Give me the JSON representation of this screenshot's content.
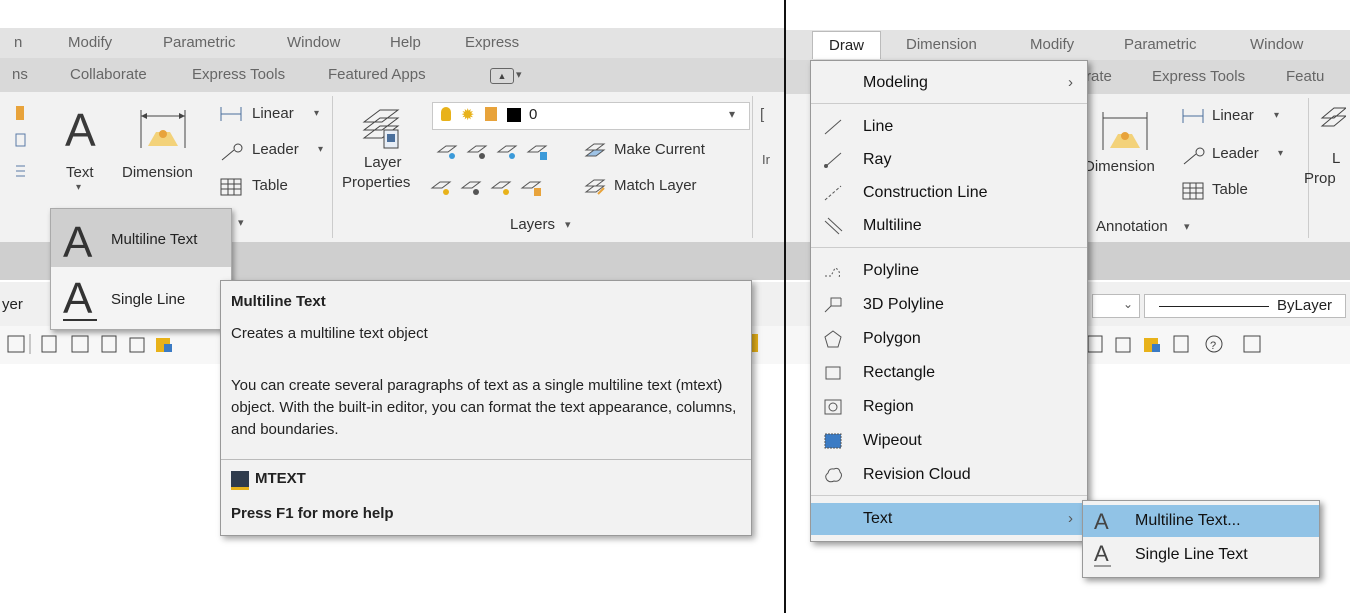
{
  "left": {
    "menubar": [
      "n",
      "Modify",
      "Parametric",
      "Window",
      "Help",
      "Express"
    ],
    "tabs": [
      "ns",
      "Collaborate",
      "Express Tools",
      "Featured Apps"
    ],
    "ribbon": {
      "text_label": "Text",
      "dimension_label": "Dimension",
      "linear_label": "Linear",
      "leader_label": "Leader",
      "table_label": "Table",
      "layer_props_label_1": "Layer",
      "layer_props_label_2": "Properties",
      "layer_value": "0",
      "make_current_label": "Make Current",
      "match_layer_label": "Match Layer",
      "layers_panel_label": "Layers",
      "edge_label": "Ir"
    },
    "propbar": {
      "layer_fragment": "yer"
    },
    "text_dropdown": {
      "items": [
        {
          "label": "Multiline Text",
          "highlighted": true
        },
        {
          "label": "Single Line",
          "highlighted": false
        }
      ]
    },
    "tooltip": {
      "title": "Multiline Text",
      "summary": "Creates a multiline text object",
      "description": "You can create several paragraphs of text as a single multiline text (mtext) object. With the built-in editor, you can format the text appearance, columns, and boundaries.",
      "command": "MTEXT",
      "help": "Press F1 for more help"
    }
  },
  "right": {
    "menubar": [
      "Draw",
      "Dimension",
      "Modify",
      "Parametric",
      "Window"
    ],
    "tabs": [
      "rate",
      "Express Tools",
      "Featu"
    ],
    "ribbon": {
      "dimension_label": "Dimension",
      "linear_label": "Linear",
      "leader_label": "Leader",
      "table_label": "Table",
      "annotation_label": "Annotation",
      "layer_fragment_1": "L",
      "layer_fragment_2": "Prop"
    },
    "propbar": {
      "linetype_value": "ByLayer"
    },
    "draw_menu": {
      "items": [
        {
          "label": "Modeling",
          "icon": "none-icon",
          "submenu": true
        },
        {
          "label": "Line",
          "icon": "line-icon",
          "submenu": false
        },
        {
          "label": "Ray",
          "icon": "ray-icon",
          "submenu": false
        },
        {
          "label": "Construction Line",
          "icon": "construction-line-icon",
          "submenu": false
        },
        {
          "label": "Multiline",
          "icon": "multiline-icon",
          "submenu": false
        },
        {
          "label": "Polyline",
          "icon": "polyline-icon",
          "submenu": false
        },
        {
          "label": "3D Polyline",
          "icon": "3d-polyline-icon",
          "submenu": false
        },
        {
          "label": "Polygon",
          "icon": "polygon-icon",
          "submenu": false
        },
        {
          "label": "Rectangle",
          "icon": "rectangle-icon",
          "submenu": false
        },
        {
          "label": "Region",
          "icon": "region-icon",
          "submenu": false
        },
        {
          "label": "Wipeout",
          "icon": "wipeout-icon",
          "submenu": false
        },
        {
          "label": "Revision Cloud",
          "icon": "revision-cloud-icon",
          "submenu": false
        },
        {
          "label": "Text",
          "icon": "none-icon",
          "submenu": true,
          "highlighted": true
        }
      ]
    },
    "text_submenu": {
      "items": [
        {
          "label": "Multiline Text...",
          "highlighted": true
        },
        {
          "label": "Single Line Text",
          "highlighted": false
        }
      ]
    }
  },
  "colors": {
    "menu_highlight": "#91c3e6",
    "dropdown_highlight": "#cfcfcf",
    "ribbon_bg": "#f2f2f2"
  }
}
